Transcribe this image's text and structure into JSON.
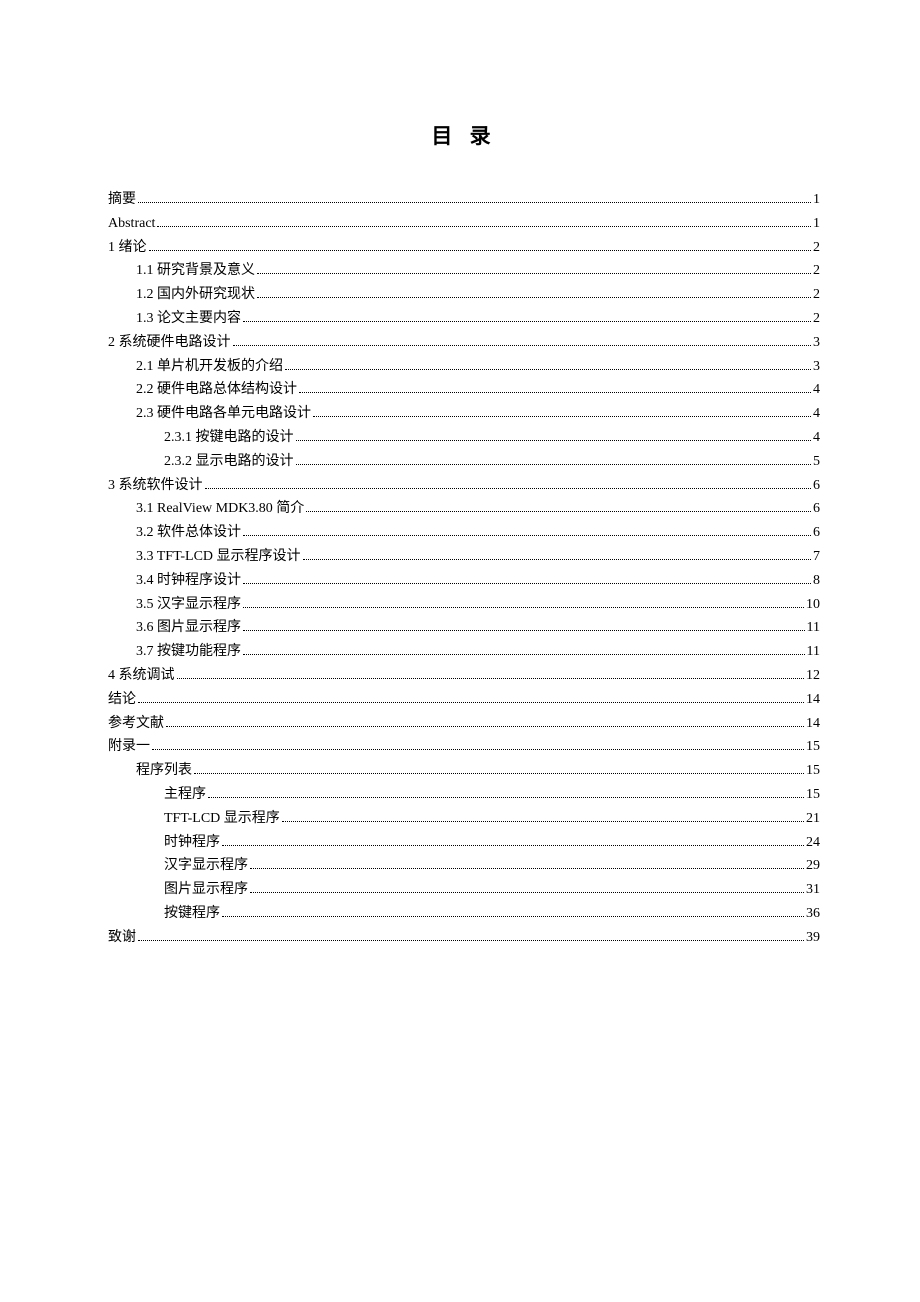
{
  "title": "目 录",
  "entries": [
    {
      "label": "摘要",
      "page": "1",
      "indent": 0
    },
    {
      "label": "Abstract",
      "page": "1",
      "indent": 0
    },
    {
      "label": "1 绪论",
      "page": "2",
      "indent": 0
    },
    {
      "label": "1.1  研究背景及意义",
      "page": "2",
      "indent": 1
    },
    {
      "label": "1.2  国内外研究现状",
      "page": "2",
      "indent": 1
    },
    {
      "label": "1.3  论文主要内容",
      "page": "2",
      "indent": 1
    },
    {
      "label": "2 系统硬件电路设计",
      "page": "3",
      "indent": 0
    },
    {
      "label": "2.1 单片机开发板的介绍",
      "page": "3",
      "indent": 1
    },
    {
      "label": "2.2 硬件电路总体结构设计",
      "page": "4",
      "indent": 1
    },
    {
      "label": "2.3  硬件电路各单元电路设计",
      "page": "4",
      "indent": 1
    },
    {
      "label": "2.3.1 按键电路的设计",
      "page": "4",
      "indent": 2
    },
    {
      "label": "2.3.2  显示电路的设计",
      "page": "5",
      "indent": 2
    },
    {
      "label": "3 系统软件设计",
      "page": "6",
      "indent": 0
    },
    {
      "label": "3.1   RealView MDK3.80 简介",
      "page": "6",
      "indent": 1
    },
    {
      "label": "3.2  软件总体设计",
      "page": "6",
      "indent": 1
    },
    {
      "label": "3.3 TFT-LCD 显示程序设计",
      "page": "7",
      "indent": 1
    },
    {
      "label": "3.4  时钟程序设计",
      "page": "8",
      "indent": 1
    },
    {
      "label": "3.5  汉字显示程序",
      "page": "10",
      "indent": 1
    },
    {
      "label": "3.6  图片显示程序",
      "page": "11",
      "indent": 1
    },
    {
      "label": "3.7 按键功能程序",
      "page": "11",
      "indent": 1
    },
    {
      "label": "4 系统调试",
      "page": "12",
      "indent": 0
    },
    {
      "label": "结论",
      "page": "14",
      "indent": 0
    },
    {
      "label": "参考文献",
      "page": "14",
      "indent": 0
    },
    {
      "label": "附录一",
      "page": "15",
      "indent": 0
    },
    {
      "label": "程序列表",
      "page": "15",
      "indent": 1
    },
    {
      "label": "主程序",
      "page": "15",
      "indent": 2
    },
    {
      "label": "TFT-LCD 显示程序",
      "page": "21",
      "indent": 2
    },
    {
      "label": "时钟程序",
      "page": "24",
      "indent": 2
    },
    {
      "label": "汉字显示程序",
      "page": "29",
      "indent": 2
    },
    {
      "label": "图片显示程序",
      "page": "31",
      "indent": 2
    },
    {
      "label": "按键程序",
      "page": "36",
      "indent": 2
    },
    {
      "label": "致谢",
      "page": "39",
      "indent": 0
    }
  ]
}
